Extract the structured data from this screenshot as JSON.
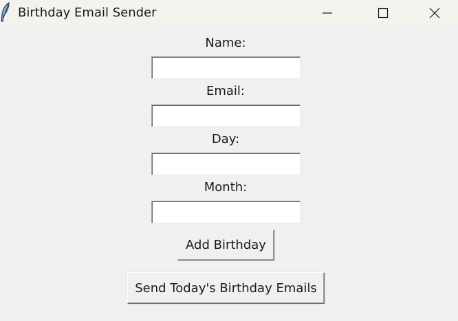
{
  "window": {
    "title": "Birthday Email Sender",
    "icon": "feather-icon"
  },
  "form": {
    "name_label": "Name:",
    "name_value": "",
    "email_label": "Email:",
    "email_value": "",
    "day_label": "Day:",
    "day_value": "",
    "month_label": "Month:",
    "month_value": ""
  },
  "buttons": {
    "add_label": "Add Birthday",
    "send_label": "Send Today's Birthday Emails"
  }
}
